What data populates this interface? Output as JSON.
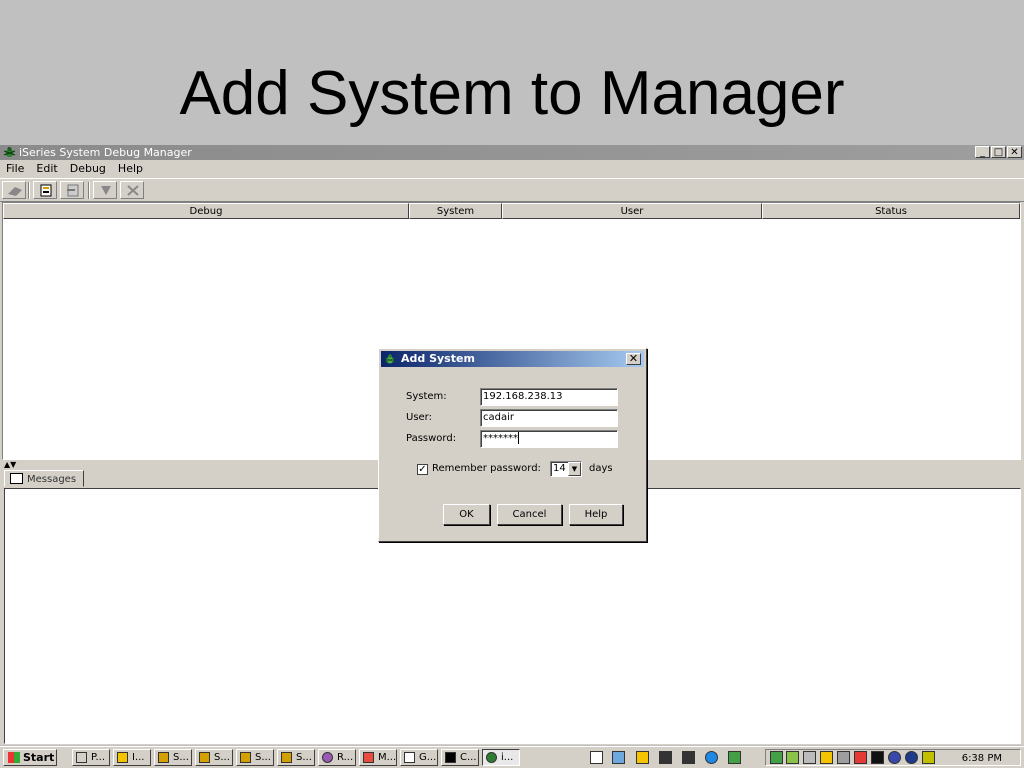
{
  "slide": {
    "title": "Add System to Manager"
  },
  "window": {
    "title": "iSeries System Debug Manager",
    "controls": {
      "minimize": "_",
      "maximize": "□",
      "close": "✕"
    }
  },
  "menu": [
    "File",
    "Edit",
    "Debug",
    "Help"
  ],
  "toolbar": {
    "icons": [
      "connect-icon",
      "add-system-icon",
      "remove-system-icon",
      "start-debug-icon",
      "stop-debug-icon"
    ]
  },
  "table": {
    "columns": [
      "Debug",
      "System",
      "User",
      "Status"
    ]
  },
  "messages_tab": {
    "label": "Messages"
  },
  "dialog": {
    "title": "Add System",
    "close": "✕",
    "fields": {
      "system_label": "System:",
      "system_value": "192.168.238.13",
      "user_label": "User:",
      "user_value": "cadair",
      "password_label": "Password:",
      "password_value": "*******"
    },
    "remember_checked": "✓",
    "remember_label": "Remember password:",
    "days_value": "14",
    "days_label": "days",
    "buttons": {
      "ok": "OK",
      "cancel": "Cancel",
      "help": "Help"
    }
  },
  "taskbar": {
    "start": "Start",
    "tasks": [
      "P...",
      "I...",
      "S...",
      "S...",
      "S...",
      "S...",
      "R...",
      "M...",
      "G...",
      "C...",
      "i..."
    ],
    "clock": "6:38 PM"
  }
}
